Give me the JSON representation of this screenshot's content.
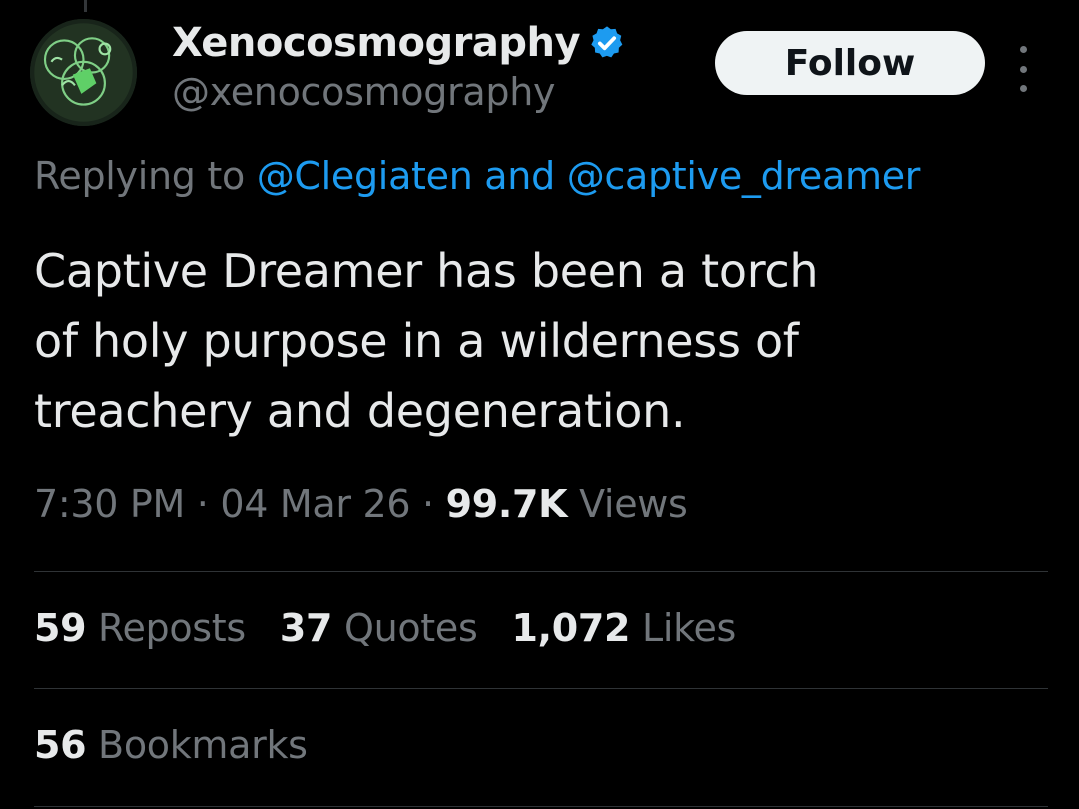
{
  "author": {
    "display_name": "Xenocosmography",
    "handle": "@xenocosmography",
    "verified": true,
    "avatar_icon": "alien-sigil-avatar"
  },
  "follow_label": "Follow",
  "more_icon": "vertical-ellipsis-icon",
  "reply": {
    "prefix": "Replying to ",
    "mention_1": "@Clegiaten",
    "conjunction": " and ",
    "mention_2": "@captive_dreamer"
  },
  "tweet": {
    "lines": [
      "Captive Dreamer has been a torch",
      "of holy purpose in a wilderness of",
      "treachery and degeneration."
    ]
  },
  "meta": {
    "time": "7:30 PM",
    "separator": " · ",
    "date": "04 Mar 26",
    "views_count": "99.7K",
    "views_label": " Views"
  },
  "stats": {
    "reposts_count": "59",
    "reposts_label": " Reposts",
    "quotes_count": "37",
    "quotes_label": " Quotes",
    "likes_count": "1,072",
    "likes_label": " Likes",
    "bookmarks_count": "56",
    "bookmarks_label": " Bookmarks"
  },
  "colors": {
    "background": "#000000",
    "text_primary": "#e7e9ea",
    "text_secondary": "#71767b",
    "link": "#1d9bf0",
    "divider": "#2f3336",
    "follow_bg": "#eff3f4"
  }
}
